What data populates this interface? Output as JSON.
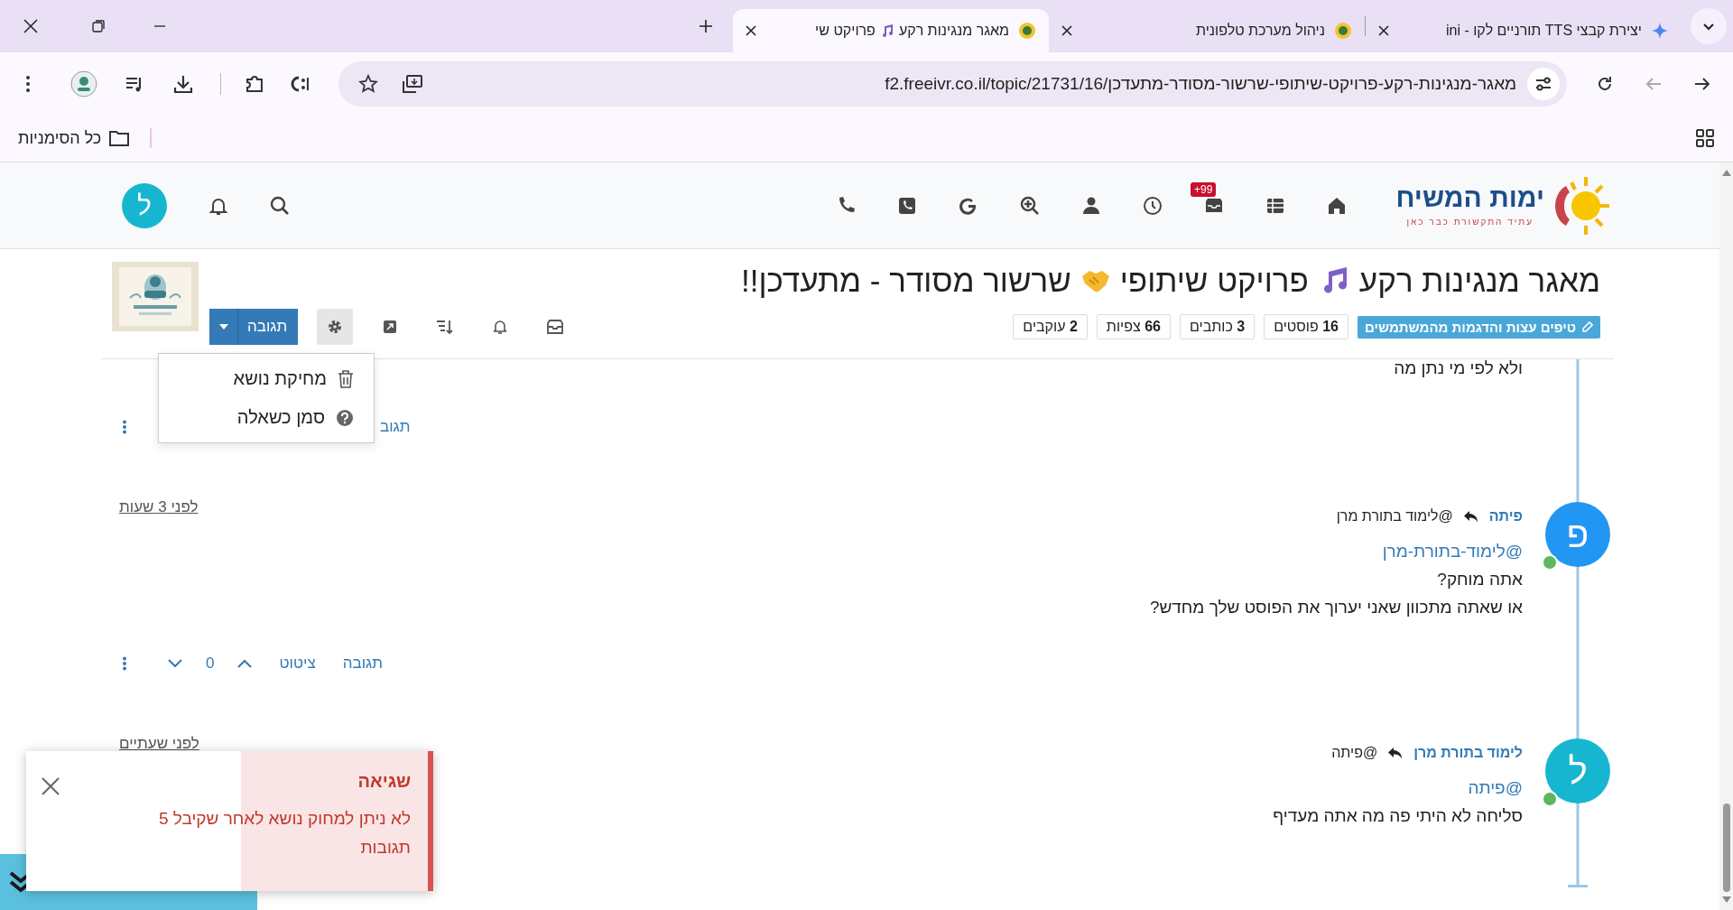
{
  "browser": {
    "tabs": [
      {
        "title": [
          "יצירת קבצי TTS תורניים לקו - ini"
        ],
        "selected": false
      },
      {
        "title": [
          "ניהול מערכת טלפונית"
        ],
        "selected": false
      },
      {
        "title": [
          "מאגר מנגינות רקע",
          "פרויקט שי"
        ],
        "selected": true
      }
    ],
    "url": "f2.freeivr.co.il/topic/21731/16/מאגר-מנגינות-רקע-פרויקט-שיתופי-שרשור-מסודר-מתעדכן",
    "bookmarks_folder": "כל הסימניות"
  },
  "header": {
    "logo_title": "ימות המשיח",
    "logo_tagline": "עתיד התקשורת כבר כאן",
    "inbox_badge": "+99",
    "user_initial": "ל"
  },
  "topic": {
    "title": [
      {
        "text": "מאגר מנגינות רקע"
      },
      {
        "text": "פרויקט שיתופי"
      },
      {
        "text": "שרשור מסודר - מתעדכן!!"
      }
    ],
    "category": "טיפים עצות והדגמות מהמשתמשים",
    "stats": [
      "**16** פוסטים",
      "**3** כותבים",
      "**66** צפיות",
      "**2** עוקבים"
    ],
    "reply_button": "תגובה",
    "tools_open": true,
    "tools_menu": [
      {
        "label": "מחיקת נושא",
        "kind": "delete"
      },
      {
        "label": "סמן כשאלה",
        "kind": "question"
      }
    ]
  },
  "posts": [
    {
      "kind": "partial",
      "lines": [
        "ולא לפי מי נתן מה"
      ],
      "actions": {
        "reply": "תגוב"
      }
    },
    {
      "kind": "full",
      "author": "פיתה",
      "initial": "פ",
      "color": "#2196f3",
      "online": true,
      "reply_to": "@לימוד בתורת מרן",
      "time": "לפני 3 שעות",
      "mention": "@לימוד-בתורת-מרן",
      "lines": [
        "אתה מוחק?",
        "או שאתה מתכוון שאני יערוך את הפוסט שלך מחדש?"
      ],
      "actions": {
        "reply": "תגובה",
        "quote": "ציטוט",
        "votes": "0"
      }
    },
    {
      "kind": "full",
      "author": "לימוד בתורת מרן",
      "initial": "ל",
      "color": "#17b6d0",
      "online": true,
      "reply_to": "@פיתה",
      "time": "לפני שעתיים",
      "mention": "@פיתה",
      "lines": [
        "סליחה לא היתי פה מה אתה מעדיף"
      ]
    }
  ],
  "toast": {
    "title": "שגיאה",
    "message": "לא ניתן למחוק נושא לאחר שקיבל 5 תגובות"
  }
}
